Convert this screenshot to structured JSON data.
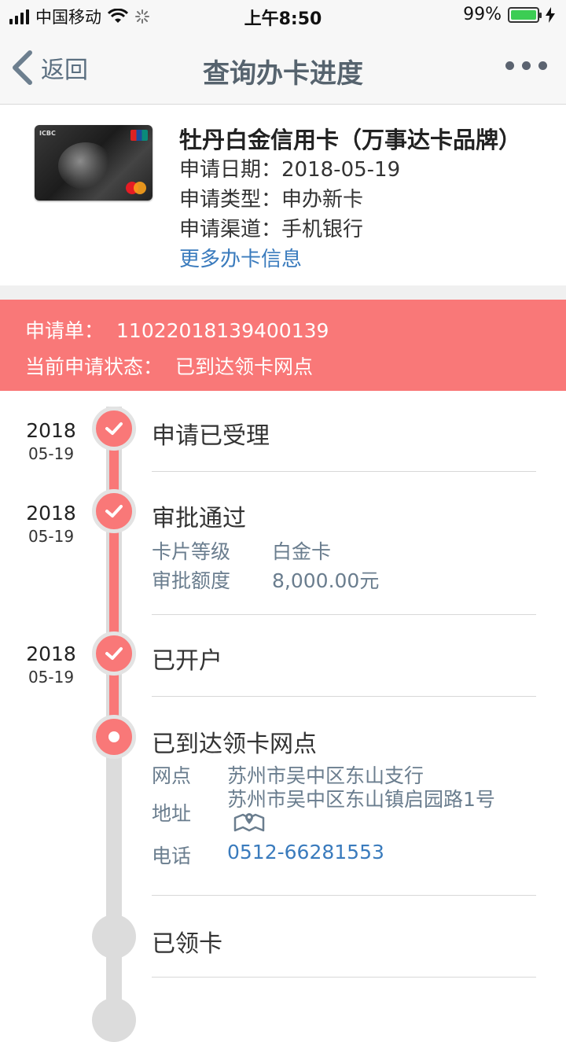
{
  "status_bar": {
    "carrier": "中国移动",
    "time": "上午8:50",
    "battery_percent": "99%",
    "battery_level": 0.99
  },
  "nav": {
    "back_label": "返回",
    "title": "查询办卡进度"
  },
  "card": {
    "name": "牡丹白金信用卡（万事达卡品牌）",
    "apply_date_label": "申请日期：",
    "apply_date": "2018-05-19",
    "apply_type_label": "申请类型：",
    "apply_type": "申办新卡",
    "apply_channel_label": "申请渠道：",
    "apply_channel": "手机银行",
    "more_info_link": "更多办卡信息"
  },
  "application": {
    "number_label": "申请单：",
    "number": "11022018139400139",
    "status_label": "当前申请状态：",
    "status": "已到达领卡网点"
  },
  "timeline": {
    "steps": [
      {
        "year": "2018",
        "month_day": "05-19",
        "title": "申请已受理",
        "state": "done"
      },
      {
        "year": "2018",
        "month_day": "05-19",
        "title": "审批通过",
        "state": "done",
        "details": [
          {
            "label": "卡片等级",
            "value": "白金卡"
          },
          {
            "label": "审批额度",
            "value": "8,000.00元"
          }
        ]
      },
      {
        "year": "2018",
        "month_day": "05-19",
        "title": "已开户",
        "state": "done"
      },
      {
        "title": "已到达领卡网点",
        "state": "current",
        "details": [
          {
            "label": "网点",
            "value": "苏州市吴中区东山支行"
          },
          {
            "label": "地址",
            "value": "苏州市吴中区东山镇启园路1号"
          },
          {
            "label": "电话",
            "value": "0512-66281553"
          }
        ]
      },
      {
        "title": "已领卡",
        "state": "pending"
      }
    ]
  },
  "colors": {
    "accent": "#f97878",
    "link": "#3a7bbd",
    "track_gray": "#dcdcdc",
    "battery_green": "#3ccd54"
  }
}
